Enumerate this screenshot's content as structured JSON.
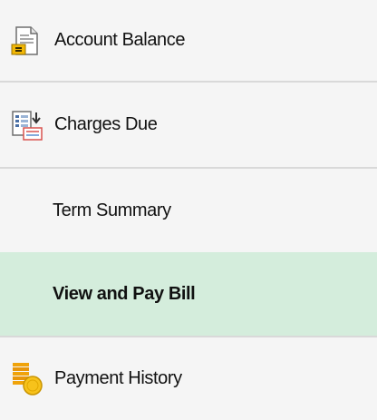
{
  "nav": {
    "items": [
      {
        "label": "Account Balance",
        "icon": "document-icon"
      },
      {
        "label": "Charges Due",
        "icon": "calculator-list-icon"
      },
      {
        "label": "Term Summary",
        "icon": ""
      },
      {
        "label": "View and Pay Bill",
        "icon": "",
        "active": true
      },
      {
        "label": "Payment History",
        "icon": "coins-icon"
      }
    ]
  },
  "colors": {
    "background": "#f5f5f5",
    "active_background": "#d4eddc",
    "divider": "#d9d9d9",
    "text": "#111111"
  }
}
